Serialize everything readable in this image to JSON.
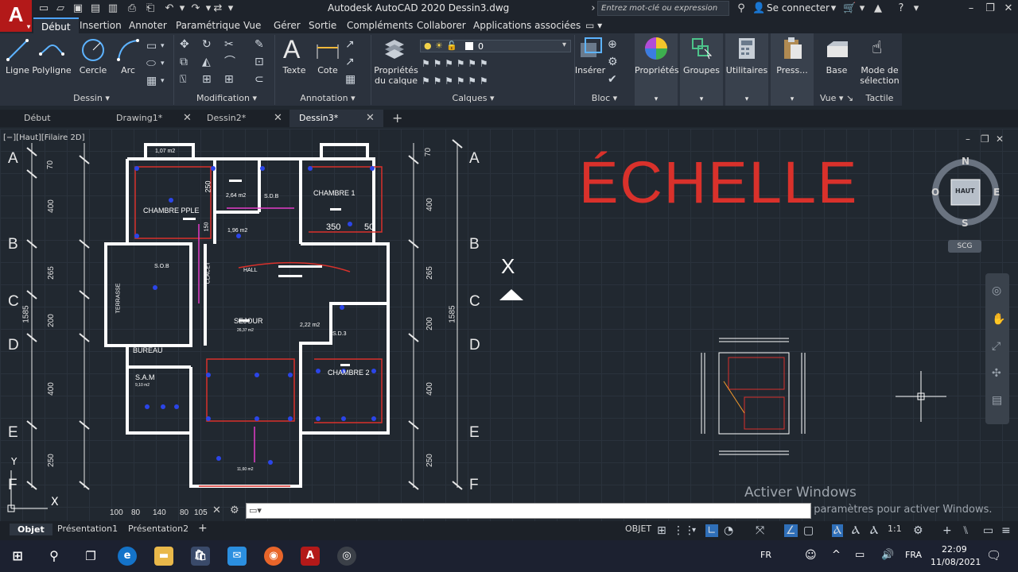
{
  "titlebar": {
    "title": "Autodesk AutoCAD 2020    Dessin3.dwg",
    "search_placeholder": "Entrez mot-clé ou expression",
    "signin": "Se connecter"
  },
  "app_letter": "A",
  "menu_tabs": [
    "Début",
    "Insertion",
    "Annoter",
    "Paramétrique",
    "Vue",
    "Gérer",
    "Sortie",
    "Compléments",
    "Collaborer",
    "Applications associées"
  ],
  "ribbon": {
    "dessin": {
      "label": "Dessin",
      "tools": [
        "Ligne",
        "Polyligne",
        "Cercle",
        "Arc"
      ]
    },
    "modification": {
      "label": "Modification"
    },
    "annotation": {
      "label": "Annotation",
      "tools": [
        "Texte",
        "Cote"
      ]
    },
    "calques": {
      "label": "Calques",
      "tool": "Propriétés du calque",
      "tool_line1": "Propriétés",
      "tool_line2": "du calque",
      "layer_value": "0"
    },
    "bloc": {
      "label": "Bloc",
      "tool": "Insérer"
    },
    "proprietes": {
      "label": "Propriétés"
    },
    "groupes": {
      "label": "Groupes"
    },
    "utilitaires": {
      "label": "Utilitaires"
    },
    "presse": {
      "label": "Press..."
    },
    "vue": {
      "tool": "Base",
      "label": "Vue"
    },
    "tactile": {
      "tool_line1": "Mode de",
      "tool_line2": "sélection",
      "label": "Tactile"
    }
  },
  "doc_tabs": [
    {
      "label": "Début",
      "closable": false,
      "active": false
    },
    {
      "label": "Drawing1*",
      "closable": true,
      "active": false
    },
    {
      "label": "Dessin2*",
      "closable": true,
      "active": false
    },
    {
      "label": "Dessin3*",
      "closable": true,
      "active": true
    }
  ],
  "canvas": {
    "view_label": "[−][Haut][Filaire 2D]",
    "grid_letters": [
      "A",
      "B",
      "C",
      "D",
      "E",
      "F"
    ],
    "left_dims": [
      "70",
      "400",
      "265",
      "200",
      "250",
      "400",
      "250"
    ],
    "left_total": "1585",
    "right_dims": [
      "70",
      "400",
      "265",
      "200",
      "400",
      "250"
    ],
    "right_total": "1585",
    "bottom_dims": [
      "100",
      "80",
      "140",
      "80",
      "105"
    ],
    "rooms": {
      "ch_pple": "CHAMBRE PPLE",
      "ch1": "CHAMBRE 1",
      "ch2": "CHAMBRE 2",
      "sdb1": "S.D.B",
      "sdb2": "S.O.B",
      "sdb3": "S.D.3",
      "hall": "HALL",
      "sejour": "SEJOUR",
      "bureau": "BUREAU",
      "sam": "S.A.M",
      "terrasse": "TERRASSE",
      "placard": "CLACET"
    },
    "areas": {
      "a1": "1,07 m2",
      "a2": "2,64 m2",
      "a3": "1,96 m2",
      "a4": "2,22 m2",
      "a5": "26,37 m2",
      "a6": "11,60 m2",
      "a7": "9,10 m2"
    },
    "inner_dims": {
      "d350": "350",
      "d50": "50",
      "d250": "250",
      "d150": "150"
    },
    "scale_text": "ÉCHELLE",
    "axis_x": "X",
    "axis_y": "Y"
  },
  "viewcube": {
    "n": "N",
    "s": "S",
    "e": "E",
    "w": "O",
    "face": "HAUT",
    "ucs": "SCG"
  },
  "watermark": {
    "line1": "Activer Windows",
    "line2": "Accédez aux paramètres pour activer Windows."
  },
  "layout_tabs": [
    "Objet",
    "Présentation1",
    "Présentation2"
  ],
  "status": {
    "mode": "OBJET",
    "scale": "1:1"
  },
  "taskbar": {
    "lang1": "FR",
    "lang2": "FRA",
    "time": "22:09",
    "date": "11/08/2021"
  }
}
